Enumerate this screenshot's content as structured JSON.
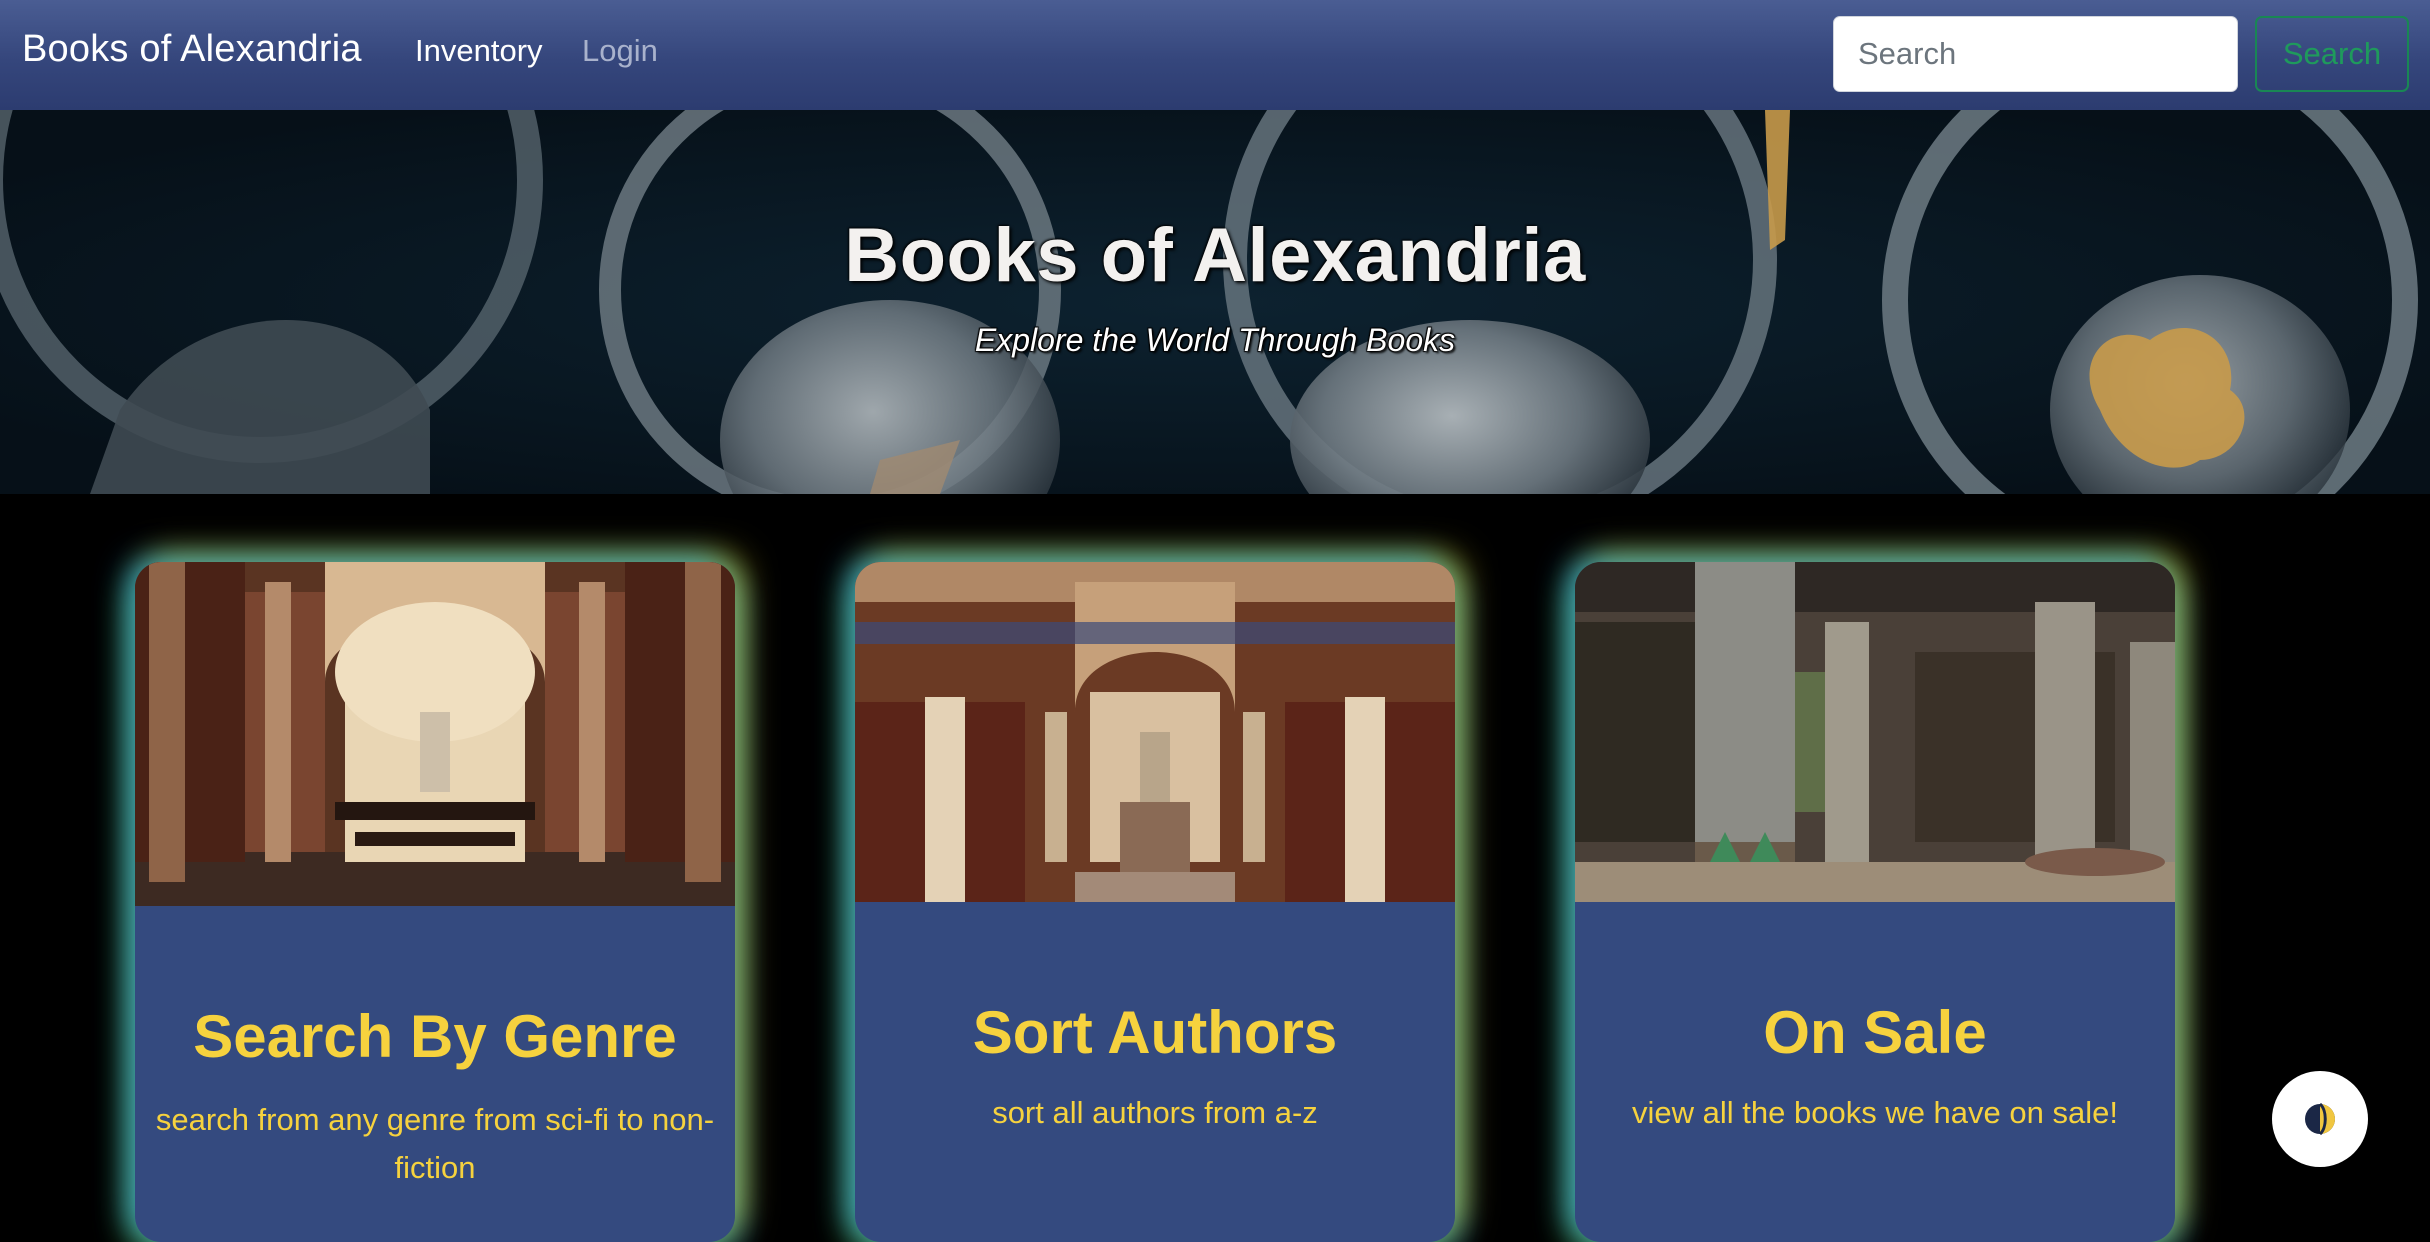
{
  "navbar": {
    "brand": "Books of Alexandria",
    "links": [
      {
        "label": "Inventory",
        "active": true
      },
      {
        "label": "Login",
        "active": false
      }
    ],
    "search": {
      "placeholder": "Search",
      "value": "",
      "button_label": "Search"
    }
  },
  "hero": {
    "title": "Books of Alexandria",
    "subtitle": "Explore the World Through Books"
  },
  "cards": [
    {
      "title": "Search By Genre",
      "text": "search from any genre from sci-fi to non-fiction"
    },
    {
      "title": "Sort Authors",
      "text": "sort all authors from a-z"
    },
    {
      "title": "On Sale",
      "text": "view all the books we have on sale!"
    }
  ],
  "theme_toggle": {
    "icon": "half-moon-icon"
  },
  "colors": {
    "navbar": "#35467c",
    "card_body": "#344a7f",
    "card_text": "#f6d23e",
    "search_button": "#198754",
    "page_background": "#000000"
  }
}
